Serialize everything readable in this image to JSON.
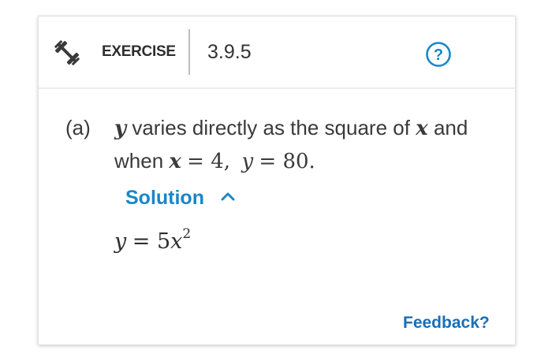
{
  "header": {
    "exercise_label": "EXERCISE",
    "exercise_number": "3.9.5",
    "exercise_icon": "dumbbell-icon",
    "help_icon": "question-circle-icon",
    "help_symbol": "?"
  },
  "question": {
    "part_label": "(a)",
    "var_y": "y",
    "text_1": "varies directly as the square of",
    "var_x": "x",
    "text_2": "and",
    "text_when": "when",
    "cond_x": "x",
    "cond_eq1": "= 4,",
    "cond_y": "y",
    "cond_eq2": "= 80."
  },
  "solution": {
    "toggle_label": "Solution",
    "toggle_icon": "chevron-up-icon",
    "answer_y": "y",
    "answer_eq": "= 5",
    "answer_x": "x",
    "answer_exp": "2"
  },
  "footer": {
    "feedback_label": "Feedback?"
  },
  "colors": {
    "link": "#1a86c8",
    "feedback": "#1a6fb5",
    "text": "#3a3a3a"
  }
}
